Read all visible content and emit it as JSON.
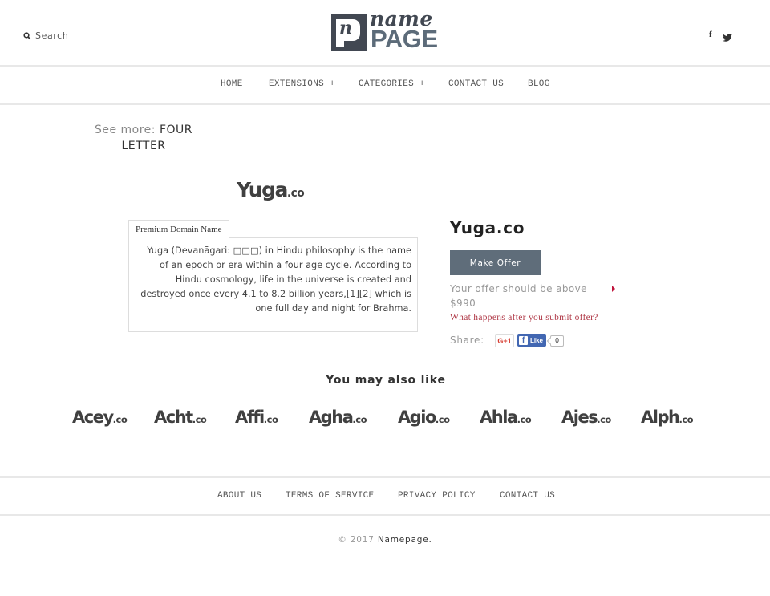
{
  "header": {
    "search_label": "Search",
    "logo": {
      "mark_letter": "n",
      "word_top": "name",
      "word_bottom": "PAGE"
    },
    "social": {
      "facebook_glyph": "f",
      "twitter": "twitter"
    }
  },
  "nav": {
    "items": [
      {
        "label": "HOME"
      },
      {
        "label": "EXTENSIONS +"
      },
      {
        "label": "CATEGORIES +"
      },
      {
        "label": "CONTACT US"
      },
      {
        "label": "BLOG"
      }
    ]
  },
  "see_more": {
    "label": "See more:",
    "link": "FOUR LETTER"
  },
  "domain": {
    "logo_name": "Yuga",
    "logo_tld": ".co",
    "title": "Yuga.co",
    "tab_label": "Premium Domain Name",
    "description": "Yuga (Devanāgari: □□□) in Hindu philosophy is the name of an epoch or era within a four age cycle. According to Hindu cosmology, life in the universe is created and destroyed once every 4.1 to 8.2 billion years,[1][2] which is one full day and night for Brahma."
  },
  "offer": {
    "button_label": "Make Offer",
    "note": "Your offer should be above $990",
    "what_happens": "What happens after you submit offer?",
    "share_label": "Share:",
    "gplus_label": "G+1",
    "fb_like_label": "Like",
    "fb_count": "0",
    "accent_color": "#c0143c"
  },
  "also_like": {
    "title": "You may also like",
    "items": [
      {
        "name": "Acey",
        "tld": ".co"
      },
      {
        "name": "Acht",
        "tld": ".co"
      },
      {
        "name": "Affi",
        "tld": ".co"
      },
      {
        "name": "Agha",
        "tld": ".co"
      },
      {
        "name": "Agio",
        "tld": ".co"
      },
      {
        "name": "Ahla",
        "tld": ".co"
      },
      {
        "name": "Ajes",
        "tld": ".co"
      },
      {
        "name": "Alph",
        "tld": ".co"
      }
    ]
  },
  "footer": {
    "links": [
      {
        "label": "ABOUT US"
      },
      {
        "label": "TERMS OF SERVICE"
      },
      {
        "label": "PRIVACY POLICY"
      },
      {
        "label": "CONTACT US"
      }
    ],
    "copyright_prefix": "© 2017",
    "copyright_name": "Namepage."
  }
}
